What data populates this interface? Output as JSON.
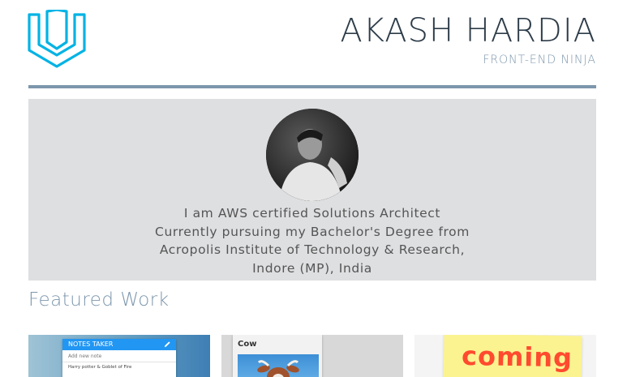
{
  "header": {
    "name": "AKASH HARDIA",
    "tagline": "FRONT-END NINJA",
    "logo_icon": "udacity-logo-icon",
    "accent_color": "#02b3e4"
  },
  "hero": {
    "avatar_icon": "profile-photo",
    "bio_lines": [
      "I am AWS certified Solutions Architect",
      "Currently pursuing my Bachelor's Degree from",
      "Acropolis Institute of Technology & Research,",
      "Indore (MP), India"
    ]
  },
  "featured": {
    "title": "Featured Work",
    "cards": [
      {
        "app_title": "NOTES TAKER",
        "input_placeholder": "Add new note",
        "item": "Harry potter & Goblet of Fire"
      },
      {
        "label": "Cow"
      },
      {
        "label": "coming"
      }
    ]
  },
  "colors": {
    "divider": "#7d97ad",
    "hero_bg": "#dedfe1",
    "title": "#2d3c49"
  }
}
